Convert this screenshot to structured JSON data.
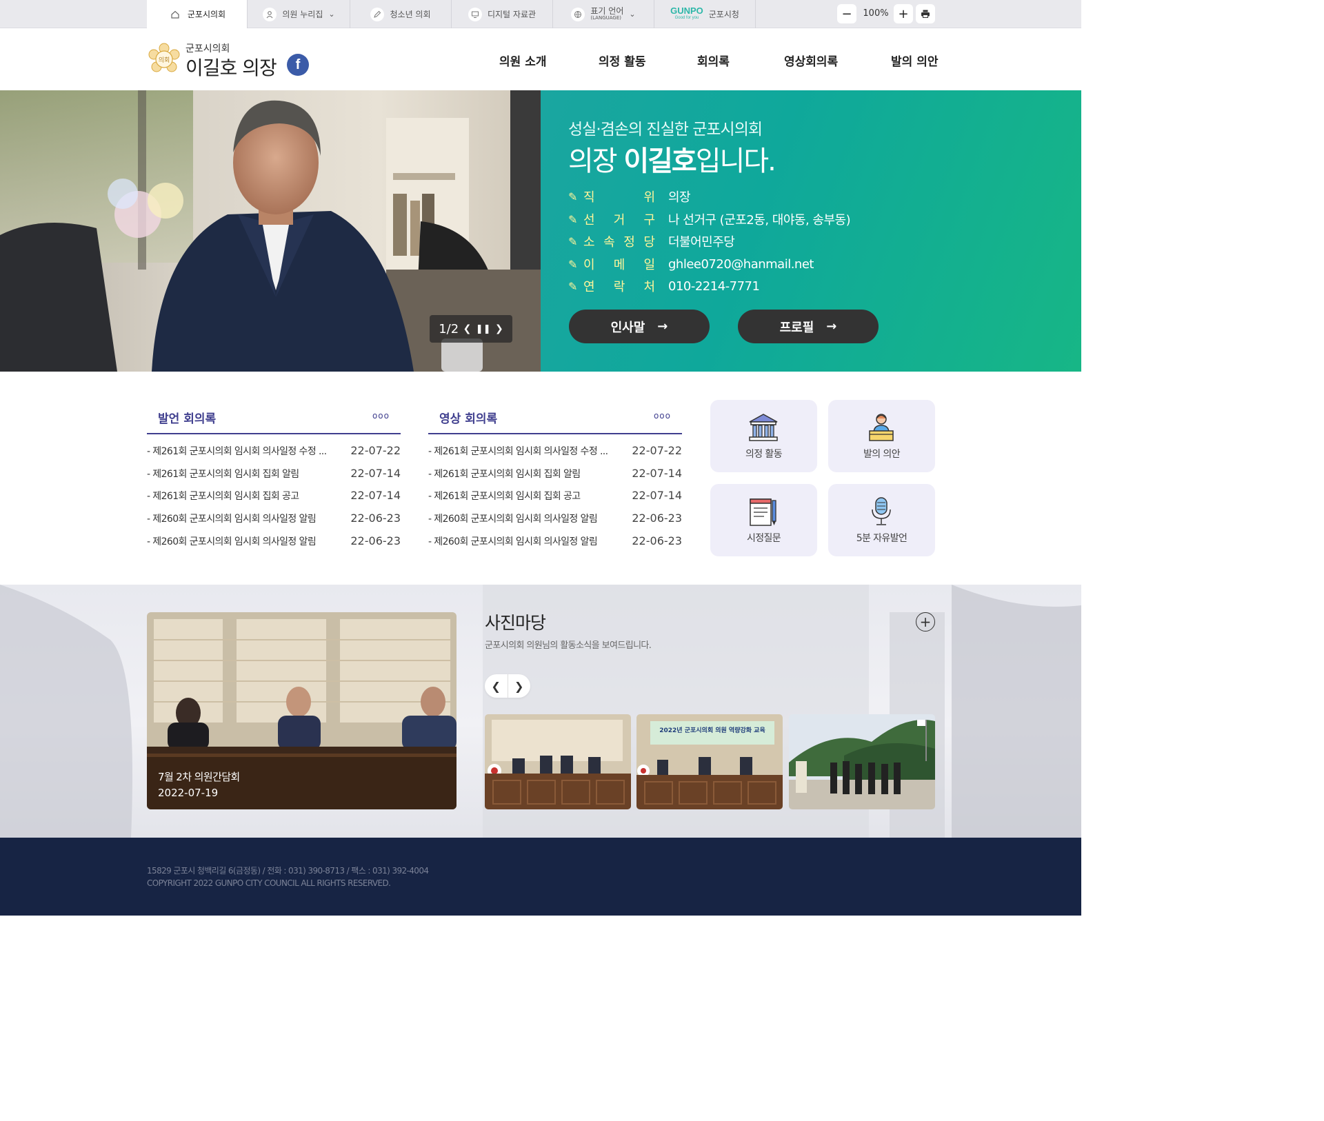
{
  "topbar": {
    "tabs": [
      {
        "label": "군포시의회",
        "icon": "home-icon"
      },
      {
        "label": "의원 누리집",
        "icon": "person-icon"
      },
      {
        "label": "청소년 의회",
        "icon": "pen-icon"
      },
      {
        "label": "디지털 자료관",
        "icon": "monitor-icon"
      },
      {
        "label": "표기 언어",
        "sub": "(LANGUAGE)",
        "icon": "globe-icon"
      },
      {
        "label": "군포시청",
        "brand": "GUNPO",
        "brand_sub": "Good for you"
      }
    ],
    "zoom": "100%"
  },
  "header": {
    "council_small": "군포시의회",
    "council_big": "이길호 의장",
    "emblem_text": "의회",
    "fb": "f",
    "nav": [
      "의원 소개",
      "의정 활동",
      "회의록",
      "영상회의록",
      "발의 의안"
    ]
  },
  "hero": {
    "subtitle": "성실·겸손의 진실한 군포시의회",
    "title_prefix": "의장 ",
    "title_name": "이길호",
    "title_suffix": "입니다.",
    "info": [
      {
        "label": [
          "직",
          "위"
        ],
        "value": "의장"
      },
      {
        "label": [
          "선",
          "거",
          "구"
        ],
        "value": "나 선거구 (군포2동, 대야동, 송부동)"
      },
      {
        "label": [
          "소",
          "속",
          "정",
          "당"
        ],
        "value": "더불어민주당"
      },
      {
        "label": [
          "이",
          "메",
          "일"
        ],
        "value": "ghlee0720@hanmail.net"
      },
      {
        "label": [
          "연",
          "락",
          "처"
        ],
        "value": "010-2214-7771"
      }
    ],
    "btn_greeting": "인사말",
    "btn_profile": "프로필",
    "slide_counter": "1/2"
  },
  "boards": [
    {
      "title": "발언 회의록",
      "more": "ooo",
      "items": [
        {
          "title": "- 제261회 군포시의회 임시회 의사일정 수정 ...",
          "date": "22-07-22"
        },
        {
          "title": "- 제261회 군포시의회 임시회 집회 알림",
          "date": "22-07-14"
        },
        {
          "title": "- 제261회 군포시의회 임시회 집회 공고",
          "date": "22-07-14"
        },
        {
          "title": "- 제260회 군포시의회 임시회 의사일정 알림",
          "date": "22-06-23"
        },
        {
          "title": "- 제260회 군포시의회 임시회 의사일정 알림",
          "date": "22-06-23"
        }
      ]
    },
    {
      "title": "영상 회의록",
      "more": "ooo",
      "items": [
        {
          "title": "- 제261회 군포시의회 임시회 의사일정 수정 ...",
          "date": "22-07-22"
        },
        {
          "title": "- 제261회 군포시의회 임시회 집회 알림",
          "date": "22-07-14"
        },
        {
          "title": "- 제261회 군포시의회 임시회 집회 공고",
          "date": "22-07-14"
        },
        {
          "title": "- 제260회 군포시의회 임시회 의사일정 알림",
          "date": "22-06-23"
        },
        {
          "title": "- 제260회 군포시의회 임시회 의사일정 알림",
          "date": "22-06-23"
        }
      ]
    }
  ],
  "quick": [
    {
      "label": "의정 활동",
      "icon": "building-icon"
    },
    {
      "label": "발의 의안",
      "icon": "speaker-icon"
    },
    {
      "label": "시정질문",
      "icon": "notepad-icon"
    },
    {
      "label": "5분 자유발언",
      "icon": "microphone-icon"
    }
  ],
  "photos": {
    "title": "사진마당",
    "desc": "군포시의회 의원님의 활동소식을 보여드립니다.",
    "main_caption": "7월 2차 의원간담회",
    "main_date": "2022-07-19",
    "thumb2_banner": "2022년 군포시의회 의원 역량강화 교육"
  },
  "footer": {
    "address": "15829 군포시 청백리길 6(금정동) / 전화 : 031) 390-8713 / 팩스 : 031) 392-4004",
    "copyright": "COPYRIGHT 2022 GUNPO CITY COUNCIL ALL RIGHTS RESERVED."
  },
  "colors": {
    "accent": "#3f3e8e",
    "hero_green": "#12a89a",
    "footer_bg": "#172444",
    "quick_bg": "#efeef9"
  }
}
